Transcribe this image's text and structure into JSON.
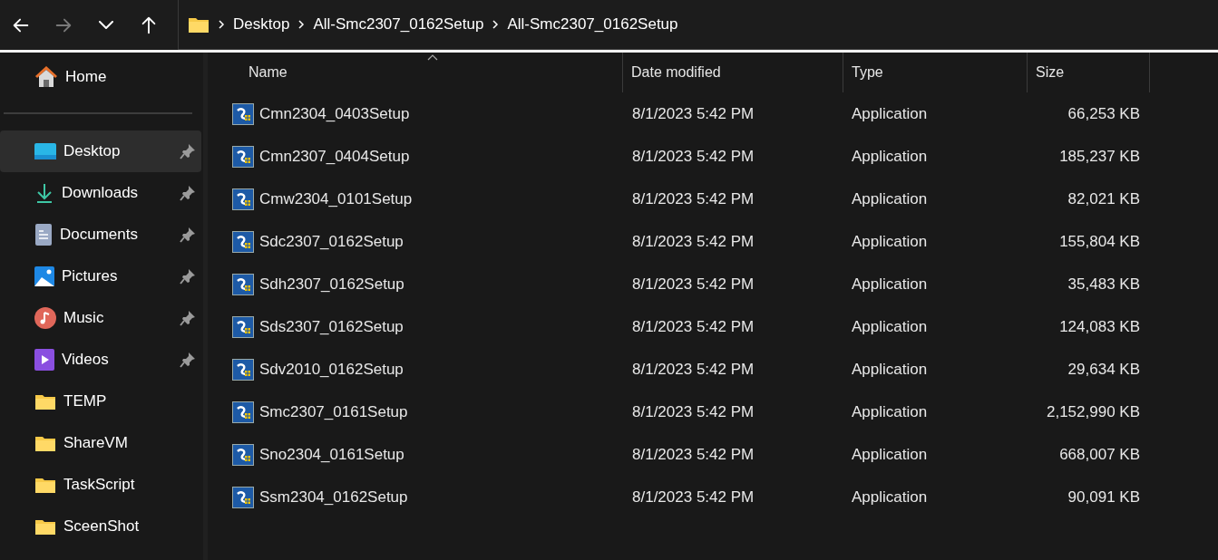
{
  "nav": [
    {
      "kind": "back",
      "disabled": false
    },
    {
      "kind": "forward",
      "disabled": true
    },
    {
      "kind": "recent",
      "disabled": false
    },
    {
      "kind": "up",
      "disabled": false
    }
  ],
  "breadcrumb": [
    "Desktop",
    "All-Smc2307_0162Setup",
    "All-Smc2307_0162Setup"
  ],
  "sidebar": {
    "home": {
      "label": "Home",
      "kind": "home",
      "selected": false
    },
    "items": [
      {
        "label": "Desktop",
        "kind": "desktop",
        "pinned": true,
        "selected": true
      },
      {
        "label": "Downloads",
        "kind": "downloads",
        "pinned": true,
        "selected": false
      },
      {
        "label": "Documents",
        "kind": "documents",
        "pinned": true,
        "selected": false
      },
      {
        "label": "Pictures",
        "kind": "pictures",
        "pinned": true,
        "selected": false
      },
      {
        "label": "Music",
        "kind": "music",
        "pinned": true,
        "selected": false
      },
      {
        "label": "Videos",
        "kind": "videos",
        "pinned": true,
        "selected": false
      },
      {
        "label": "TEMP",
        "kind": "folder",
        "pinned": false,
        "selected": false
      },
      {
        "label": "ShareVM",
        "kind": "folder",
        "pinned": false,
        "selected": false
      },
      {
        "label": "TaskScript",
        "kind": "folder",
        "pinned": false,
        "selected": false
      },
      {
        "label": "SceenShot",
        "kind": "folder",
        "pinned": false,
        "selected": false
      }
    ]
  },
  "table": {
    "columns": [
      "Name",
      "Date modified",
      "Type",
      "Size"
    ],
    "rows": [
      {
        "name": "Cmn2304_0403Setup",
        "date": "8/1/2023 5:42 PM",
        "type": "Application",
        "size": "66,253 KB"
      },
      {
        "name": "Cmn2307_0404Setup",
        "date": "8/1/2023 5:42 PM",
        "type": "Application",
        "size": "185,237 KB"
      },
      {
        "name": "Cmw2304_0101Setup",
        "date": "8/1/2023 5:42 PM",
        "type": "Application",
        "size": "82,021 KB"
      },
      {
        "name": "Sdc2307_0162Setup",
        "date": "8/1/2023 5:42 PM",
        "type": "Application",
        "size": "155,804 KB"
      },
      {
        "name": "Sdh2307_0162Setup",
        "date": "8/1/2023 5:42 PM",
        "type": "Application",
        "size": "35,483 KB"
      },
      {
        "name": "Sds2307_0162Setup",
        "date": "8/1/2023 5:42 PM",
        "type": "Application",
        "size": "124,083 KB"
      },
      {
        "name": "Sdv2010_0162Setup",
        "date": "8/1/2023 5:42 PM",
        "type": "Application",
        "size": "29,634 KB"
      },
      {
        "name": "Smc2307_0161Setup",
        "date": "8/1/2023 5:42 PM",
        "type": "Application",
        "size": "2,152,990 KB"
      },
      {
        "name": "Sno2304_0161Setup",
        "date": "8/1/2023 5:42 PM",
        "type": "Application",
        "size": "668,007 KB"
      },
      {
        "name": "Ssm2304_0162Setup",
        "date": "8/1/2023 5:42 PM",
        "type": "Application",
        "size": "90,091 KB"
      }
    ]
  }
}
